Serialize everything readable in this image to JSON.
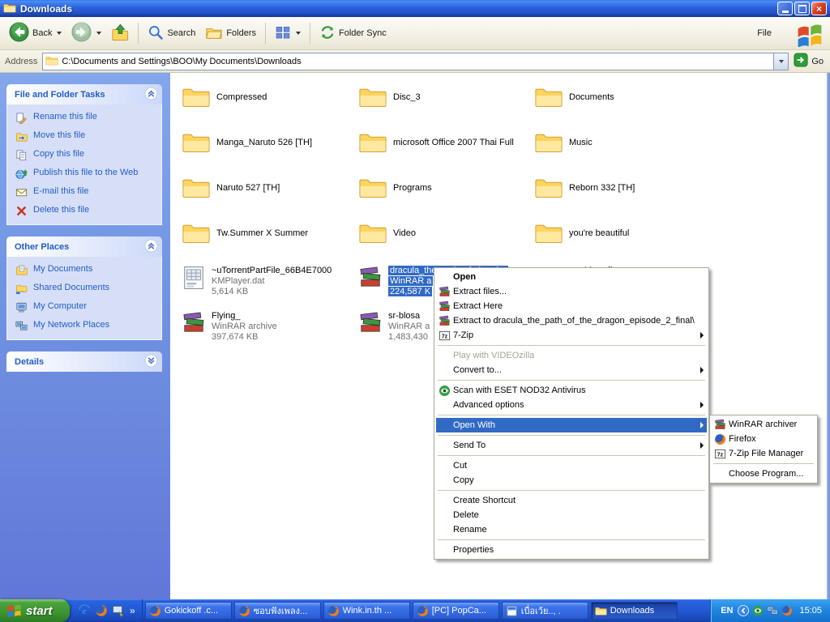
{
  "window": {
    "title": "Downloads"
  },
  "menubar": {
    "file": "File"
  },
  "toolbar": {
    "back_label": "Back",
    "search_label": "Search",
    "folders_label": "Folders",
    "sync_label": "Folder Sync"
  },
  "addressbar": {
    "label": "Address",
    "path": "C:\\Documents and Settings\\BOO\\My Documents\\Downloads",
    "go_label": "Go"
  },
  "sidebar": {
    "panels": [
      {
        "title": "File and Folder Tasks",
        "collapsed": false,
        "items": [
          {
            "icon": "rename-icon",
            "label": "Rename this file"
          },
          {
            "icon": "move-icon",
            "label": "Move this file"
          },
          {
            "icon": "copy-icon",
            "label": "Copy this file"
          },
          {
            "icon": "publish-icon",
            "label": "Publish this file to the Web"
          },
          {
            "icon": "email-icon",
            "label": "E-mail this file"
          },
          {
            "icon": "delete-icon",
            "label": "Delete this file"
          }
        ]
      },
      {
        "title": "Other Places",
        "collapsed": false,
        "items": [
          {
            "icon": "mydocs-icon",
            "label": "My Documents"
          },
          {
            "icon": "shareddocs-icon",
            "label": "Shared Documents"
          },
          {
            "icon": "computer-icon",
            "label": "My Computer"
          },
          {
            "icon": "network-icon",
            "label": "My Network Places"
          }
        ]
      },
      {
        "title": "Details",
        "collapsed": true,
        "items": []
      }
    ]
  },
  "files": {
    "folders": [
      "Compressed",
      "Disc_3",
      "Documents",
      "Manga_Naruto 526 [TH]",
      "microsoft Office 2007 Thai Full",
      "Music",
      "Naruto 527 [TH]",
      "Programs",
      "Reborn 332 [TH]",
      "Tw.Summer X Summer",
      "Video",
      "you're beautiful"
    ],
    "documents": [
      {
        "name": "~uTorrentPartFile_66B4E7000",
        "type": "KMPlayer.dat",
        "size": "5,614 KB",
        "icon": "datfile-icon",
        "col": 0,
        "row": 4,
        "selected": false
      },
      {
        "name": "dracula_the_path_of_the_dra",
        "type": "WinRAR a",
        "size": "224,587 K",
        "icon": "winrar-icon",
        "col": 1,
        "row": 4,
        "selected": true
      },
      {
        "name": "new 10 april",
        "type": "",
        "size": "",
        "icon": "scribble-icon",
        "col": 2,
        "row": 4,
        "selected": false
      },
      {
        "name": "Flying_",
        "type": "WinRAR archive",
        "size": "397,674 KB",
        "icon": "winrar-icon",
        "col": 0,
        "row": 5,
        "selected": false
      },
      {
        "name": "sr-blosa",
        "type": "WinRAR a",
        "size": "1,483,430",
        "icon": "winrar-icon",
        "col": 1,
        "row": 5,
        "selected": false
      }
    ]
  },
  "context_menu": {
    "items": [
      {
        "label": "Open",
        "bold": true
      },
      {
        "label": "Extract files...",
        "icon": "winrar-icon"
      },
      {
        "label": "Extract Here",
        "icon": "winrar-icon"
      },
      {
        "label": "Extract to dracula_the_path_of_the_dragon_episode_2_final\\",
        "icon": "winrar-icon"
      },
      {
        "label": "7-Zip",
        "icon": "sevenzip-icon",
        "submenu": true
      },
      {
        "sep": true
      },
      {
        "label": "Play with VIDEOzilla",
        "disabled": true
      },
      {
        "label": "Convert to...",
        "submenu": true
      },
      {
        "sep": true
      },
      {
        "label": "Scan with ESET NOD32 Antivirus",
        "icon": "eset-icon"
      },
      {
        "label": "Advanced options",
        "submenu": true
      },
      {
        "sep": true
      },
      {
        "label": "Open With",
        "submenu": true,
        "highlighted": true
      },
      {
        "sep": true
      },
      {
        "label": "Send To",
        "submenu": true
      },
      {
        "sep": true
      },
      {
        "label": "Cut"
      },
      {
        "label": "Copy"
      },
      {
        "sep": true
      },
      {
        "label": "Create Shortcut"
      },
      {
        "label": "Delete"
      },
      {
        "label": "Rename"
      },
      {
        "sep": true
      },
      {
        "label": "Properties"
      }
    ]
  },
  "open_with_submenu": {
    "items": [
      {
        "label": "WinRAR archiver",
        "icon": "winrar-icon"
      },
      {
        "label": "Firefox",
        "icon": "firefox-icon"
      },
      {
        "label": "7-Zip File Manager",
        "icon": "sevenzip-icon"
      },
      {
        "sep": true
      },
      {
        "label": "Choose Program..."
      }
    ]
  },
  "taskbar": {
    "start_label": "start",
    "quick_launch": [
      "ie-icon",
      "firefox-icon",
      "show-desktop-icon"
    ],
    "tasks": [
      {
        "icon": "firefox-icon",
        "label": "Gokickoff .c..."
      },
      {
        "icon": "firefox-icon",
        "label": "ซอบฟังเพลง..."
      },
      {
        "icon": "firefox-icon",
        "label": "Wink.in.th ..."
      },
      {
        "icon": "firefox-icon",
        "label": "[PC] PopCa..."
      },
      {
        "icon": "app-icon",
        "label": "เบื่อเว้ย.., ."
      },
      {
        "icon": "folder-icon",
        "label": "Downloads",
        "active": true
      }
    ],
    "tray": {
      "language": "EN",
      "icons": [
        "chevron-left-icon",
        "eset-icon",
        "network-icon",
        "firefox-icon"
      ],
      "clock": "15:05"
    }
  },
  "colors": {
    "selection": "#316ac5",
    "link": "#215dc6",
    "taskbar_blue": "#2a5ccd",
    "start_green": "#3d9430",
    "menu_highlight": "#316ac5"
  }
}
